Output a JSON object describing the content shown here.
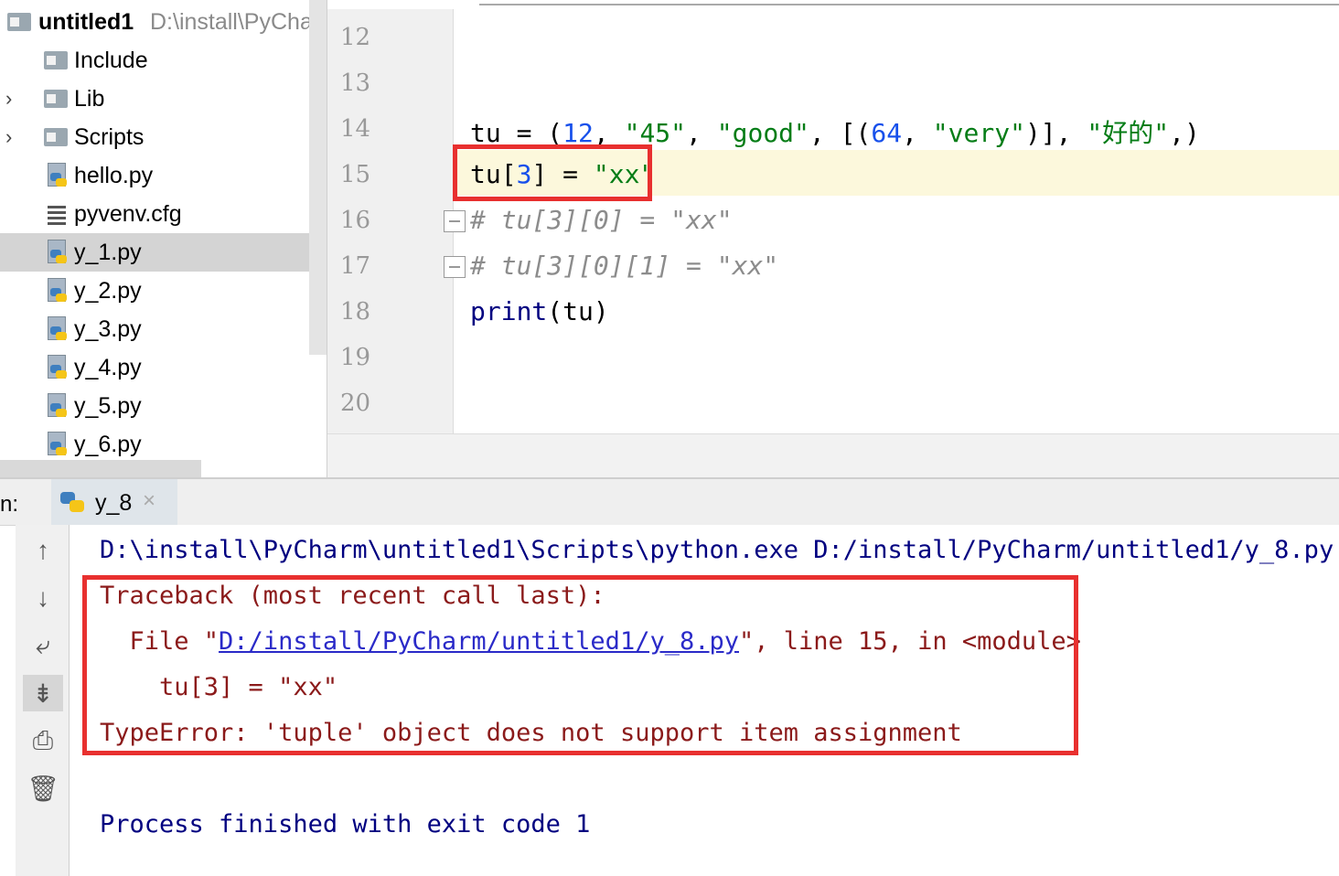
{
  "tree": {
    "root": {
      "name": "untitled1",
      "path": "D:\\install\\PyChar"
    },
    "items": [
      {
        "label": "Include",
        "type": "folder",
        "expandable": false
      },
      {
        "label": "Lib",
        "type": "folder",
        "expandable": true
      },
      {
        "label": "Scripts",
        "type": "folder",
        "expandable": true
      },
      {
        "label": "hello.py",
        "type": "py"
      },
      {
        "label": "pyvenv.cfg",
        "type": "cfg"
      },
      {
        "label": "y_1.py",
        "type": "py",
        "selected": true
      },
      {
        "label": "y_2.py",
        "type": "py"
      },
      {
        "label": "y_3.py",
        "type": "py"
      },
      {
        "label": "y_4.py",
        "type": "py"
      },
      {
        "label": "y_5.py",
        "type": "py"
      },
      {
        "label": "y_6.py",
        "type": "py"
      }
    ]
  },
  "editor": {
    "line_numbers": [
      "12",
      "13",
      "14",
      "15",
      "16",
      "17",
      "18",
      "19",
      "20"
    ],
    "code": {
      "l14": {
        "a": "tu = (",
        "n1": "12",
        "b": ", ",
        "s1": "\"45\"",
        "c": ", ",
        "s2": "\"good\"",
        "d": ", [(",
        "n2": "64",
        "e": ", ",
        "s3": "\"very\"",
        "f": ")], ",
        "s4": "\"好的\"",
        "g": ",)"
      },
      "l15": {
        "a": "tu[",
        "n": "3",
        "b": "] = ",
        "s": "\"xx\""
      },
      "l16": "# tu[3][0] = \"xx\"",
      "l17": "# tu[3][0][1] = \"xx\"",
      "l18": {
        "kw": "print",
        "rest": "(tu)"
      }
    },
    "current_line": "15"
  },
  "run": {
    "label": "n:",
    "tab_name": "y_8",
    "close": "×"
  },
  "toolbar": {
    "up": "↑",
    "down": "↓",
    "wrap": "⤶",
    "scroll": "⇟",
    "print": "⎙",
    "trash": "🗑"
  },
  "console": {
    "command": "D:\\install\\PyCharm\\untitled1\\Scripts\\python.exe D:/install/PyCharm/untitled1/y_8.py",
    "traceback_header": "Traceback (most recent call last):",
    "file_prefix": "  File \"",
    "file_link": "D:/install/PyCharm/untitled1/y_8.py",
    "file_suffix": "\", line 15, in <module>",
    "code_line": "    tu[3] = \"xx\"",
    "error": "TypeError: 'tuple' object does not support item assignment",
    "exit": "Process finished with exit code 1"
  },
  "colors": {
    "highlight_box": "#e8302f",
    "string": "#067d17",
    "number": "#1750eb",
    "console_blue": "#000080",
    "console_red": "#8b1a1a"
  }
}
